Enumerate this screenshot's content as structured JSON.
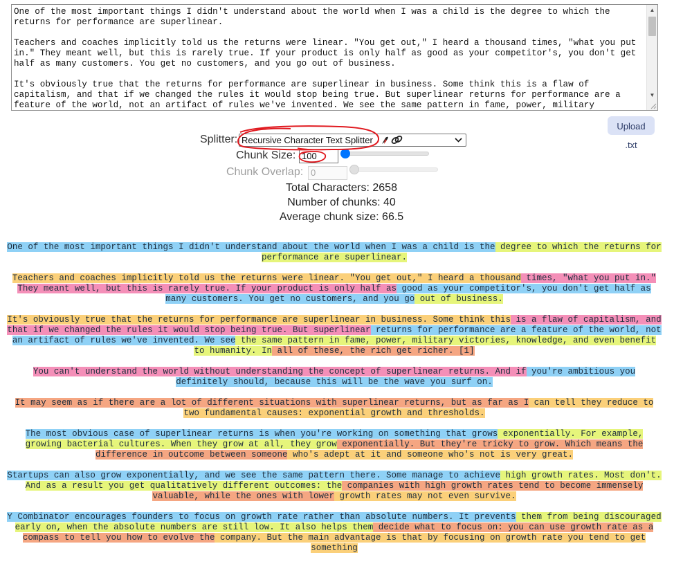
{
  "source_text": "One of the most important things I didn't understand about the world when I was a child is the degree to which the returns for performance are superlinear.\n\nTeachers and coaches implicitly told us the returns were linear. \"You get out,\" I heard a thousand times, \"what you put in.\" They meant well, but this is rarely true. If your product is only half as good as your competitor's, you don't get half as many customers. You get no customers, and you go out of business.\n\nIt's obviously true that the returns for performance are superlinear in business. Some think this is a flaw of capitalism, and that if we changed the rules it would stop being true. But superlinear returns for performance are a feature of the world, not an artifact of rules we've invented. We see the same pattern in fame, power, military victories, knowledge, and",
  "upload_label": "Upload .txt",
  "controls": {
    "splitter_label": "Splitter:",
    "splitter_value": "Recursive Character Text Splitter",
    "splitter_icons": [
      "parrot-icon",
      "link-icon"
    ],
    "chunk_size_label": "Chunk Size:",
    "chunk_size_value": "100",
    "chunk_size_slider": 0.04,
    "chunk_overlap_label": "Chunk Overlap:",
    "chunk_overlap_value": "0",
    "chunk_overlap_slider": 0
  },
  "stats": {
    "total_characters": "Total Characters: 2658",
    "num_chunks": "Number of chunks: 40",
    "avg_chunk_size": "Average chunk size: 66.5"
  },
  "colors": {
    "blue": "#8fd1f6",
    "yellow": "#e6f57b",
    "pink": "#f48fb8",
    "orange": "#f5a682",
    "peach": "#fbd07a",
    "annotation": "#e0191f",
    "slider_accent": "#0075ff"
  },
  "paragraphs": [
    [
      {
        "text": "One of the most important things I didn't understand about the world when I was a child is the",
        "color": "blue"
      },
      {
        "text": " degree to which the returns for performance are superlinear.",
        "color": "yellow"
      }
    ],
    [
      {
        "text": "Teachers and coaches implicitly told us the returns were linear. \"You get out,\" I heard a thousand",
        "color": "peach"
      },
      {
        "text": " times, \"what you put in.\" They meant well, but this is rarely true. If your product is only half as",
        "color": "pink"
      },
      {
        "text": " good as your competitor's, you don't get half as many customers. You get no customers, and you go",
        "color": "blue"
      },
      {
        "text": " out of business.",
        "color": "yellow"
      }
    ],
    [
      {
        "text": "It's obviously true that the returns for performance are superlinear in business. Some think this",
        "color": "peach"
      },
      {
        "text": " is a flaw of capitalism, and that if we changed the rules it would stop being true. But superlinear",
        "color": "pink"
      },
      {
        "text": " returns for performance are a feature of the world, not an artifact of rules we've invented. We see",
        "color": "blue"
      },
      {
        "text": " the same pattern in fame, power, military victories, knowledge, and even benefit to humanity. In",
        "color": "yellow"
      },
      {
        "text": " all of these, the rich get richer. [1]",
        "color": "orange"
      }
    ],
    [
      {
        "text": "You can't understand the world without understanding the concept of superlinear returns. And if",
        "color": "pink"
      },
      {
        "text": " you're ambitious you definitely should, because this will be the wave you surf on.",
        "color": "blue"
      }
    ],
    [
      {
        "text": "It may seem as if there are a lot of different situations with superlinear returns, but as far as I",
        "color": "orange"
      },
      {
        "text": " can tell they reduce to two fundamental causes: exponential growth and thresholds.",
        "color": "peach"
      }
    ],
    [
      {
        "text": "The most obvious case of superlinear returns is when you're working on something that grows",
        "color": "blue"
      },
      {
        "text": " exponentially. For example, growing bacterial cultures. When they grow at all, they grow",
        "color": "yellow"
      },
      {
        "text": " exponentially. But they're tricky to grow. Which means the difference in outcome between someone",
        "color": "orange"
      },
      {
        "text": " who's adept at it and someone who's not is very great.",
        "color": "peach"
      }
    ],
    [
      {
        "text": "Startups can also grow exponentially, and we see the same pattern there. Some manage to achieve",
        "color": "blue"
      },
      {
        "text": " high growth rates. Most don't. And as a result you get qualitatively different outcomes: the",
        "color": "yellow"
      },
      {
        "text": " companies with high growth rates tend to become immensely valuable, while the ones with lower",
        "color": "orange"
      },
      {
        "text": " growth rates may not even survive.",
        "color": "peach"
      }
    ],
    [
      {
        "text": "Y Combinator encourages founders to focus on growth rate rather than absolute numbers. It prevents",
        "color": "blue"
      },
      {
        "text": " them from being discouraged early on, when the absolute numbers are still low. It also helps them",
        "color": "yellow"
      },
      {
        "text": " decide what to focus on: you can use growth rate as a compass to tell you how to evolve the",
        "color": "orange"
      },
      {
        "text": " company. But the main advantage is that by focusing on growth rate you tend to get something",
        "color": "peach"
      }
    ]
  ]
}
